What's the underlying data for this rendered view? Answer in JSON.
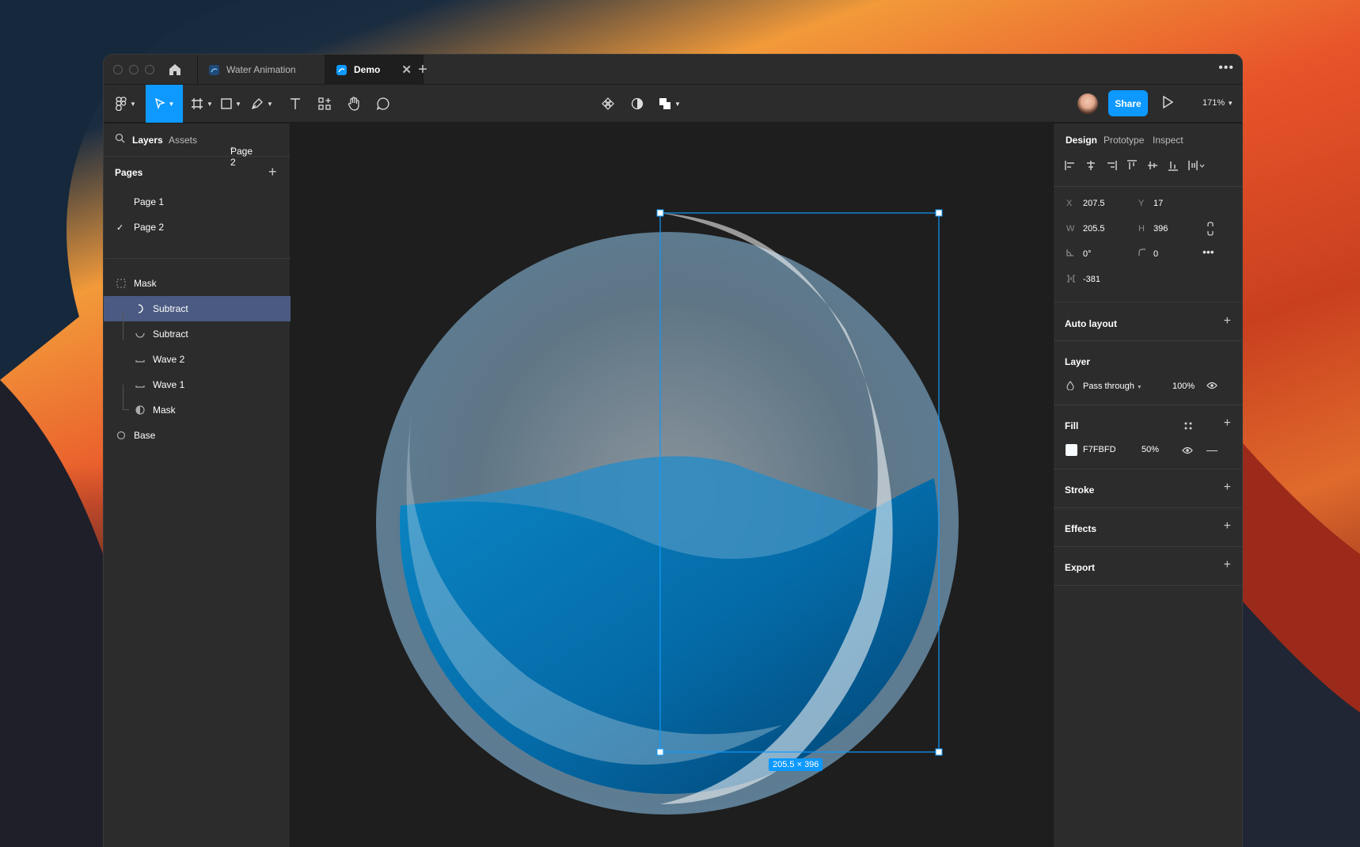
{
  "tabs": [
    {
      "label": "Water Animation"
    },
    {
      "label": "Demo"
    }
  ],
  "toolbar": {
    "share_label": "Share",
    "zoom": "171%"
  },
  "left_panel": {
    "tab_layers": "Layers",
    "tab_assets": "Assets",
    "page_selector": "Page 2",
    "pages_heading": "Pages",
    "pages": [
      {
        "label": "Page 1",
        "current": false
      },
      {
        "label": "Page 2",
        "current": true
      }
    ],
    "layers": [
      {
        "label": "Mask",
        "icon": "frame-icon",
        "selected": false
      },
      {
        "label": "Subtract",
        "icon": "subtract-crescent-icon",
        "selected": true
      },
      {
        "label": "Subtract",
        "icon": "subtract-curve-icon",
        "selected": false
      },
      {
        "label": "Wave 2",
        "icon": "wave-icon",
        "selected": false
      },
      {
        "label": "Wave 1",
        "icon": "wave-icon",
        "selected": false
      },
      {
        "label": "Mask",
        "icon": "mask-icon",
        "selected": false
      },
      {
        "label": "Base",
        "icon": "ellipse-icon",
        "selected": false
      }
    ]
  },
  "canvas": {
    "selection_size_label": "205.5 × 396"
  },
  "right_panel": {
    "tab_design": "Design",
    "tab_prototype": "Prototype",
    "tab_inspect": "Inspect",
    "x_label": "X",
    "x_value": "207.5",
    "y_label": "Y",
    "y_value": "17",
    "w_label": "W",
    "w_value": "205.5",
    "h_label": "H",
    "h_value": "396",
    "rotation_value": "0°",
    "radius_value": "0",
    "spacing_value": "-381",
    "auto_layout": "Auto layout",
    "layer_heading": "Layer",
    "blend_mode": "Pass through",
    "layer_opacity": "100%",
    "fill_heading": "Fill",
    "fill_hex": "F7FBFD",
    "fill_opacity": "50%",
    "stroke_heading": "Stroke",
    "effects_heading": "Effects",
    "export_heading": "Export"
  },
  "colors": {
    "accent": "#0d99ff",
    "selected_layer": "#4a5a82",
    "fill_swatch": "#f7fbfd"
  }
}
